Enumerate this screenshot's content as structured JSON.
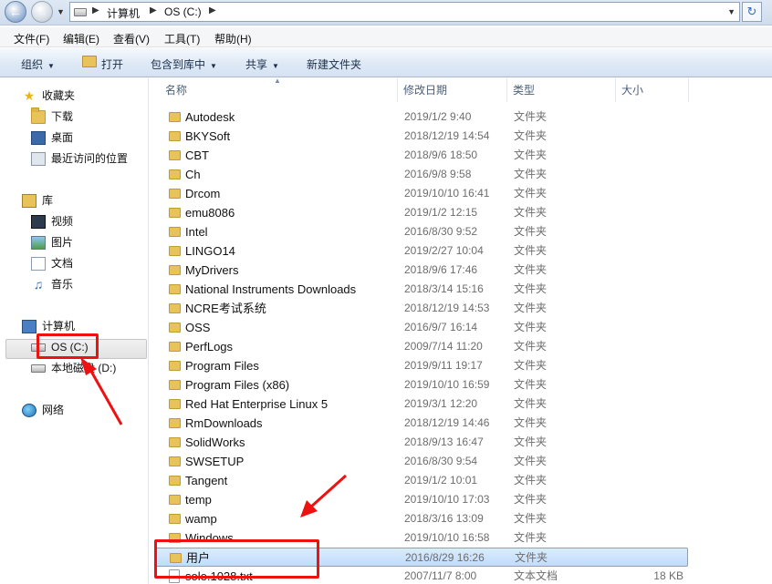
{
  "address_bar": {
    "crumbs": [
      "计算机",
      "OS (C:)"
    ]
  },
  "menu": [
    "文件(F)",
    "编辑(E)",
    "查看(V)",
    "工具(T)",
    "帮助(H)"
  ],
  "toolbar": {
    "organize": "组织",
    "open": "打开",
    "include_library": "包含到库中",
    "share": "共享",
    "new_folder": "新建文件夹"
  },
  "nav": {
    "favorites": {
      "label": "收藏夹",
      "items": [
        "下载",
        "桌面",
        "最近访问的位置"
      ]
    },
    "libraries": {
      "label": "库",
      "items": [
        "视频",
        "图片",
        "文档",
        "音乐"
      ]
    },
    "computer": {
      "label": "计算机",
      "drives": [
        "OS (C:)",
        "本地磁盘 (D:)"
      ]
    },
    "network": {
      "label": "网络"
    }
  },
  "columns": {
    "name": "名称",
    "modified": "修改日期",
    "type": "类型",
    "size": "大小"
  },
  "files": [
    {
      "name": "Autodesk",
      "date": "2019/1/2 9:40",
      "type": "文件夹",
      "size": ""
    },
    {
      "name": "BKYSoft",
      "date": "2018/12/19 14:54",
      "type": "文件夹",
      "size": ""
    },
    {
      "name": "CBT",
      "date": "2018/9/6 18:50",
      "type": "文件夹",
      "size": ""
    },
    {
      "name": "Ch",
      "date": "2016/9/8 9:58",
      "type": "文件夹",
      "size": ""
    },
    {
      "name": "Drcom",
      "date": "2019/10/10 16:41",
      "type": "文件夹",
      "size": ""
    },
    {
      "name": "emu8086",
      "date": "2019/1/2 12:15",
      "type": "文件夹",
      "size": ""
    },
    {
      "name": "Intel",
      "date": "2016/8/30 9:52",
      "type": "文件夹",
      "size": ""
    },
    {
      "name": "LINGO14",
      "date": "2019/2/27 10:04",
      "type": "文件夹",
      "size": ""
    },
    {
      "name": "MyDrivers",
      "date": "2018/9/6 17:46",
      "type": "文件夹",
      "size": ""
    },
    {
      "name": "National Instruments Downloads",
      "date": "2018/3/14 15:16",
      "type": "文件夹",
      "size": ""
    },
    {
      "name": "NCRE考试系统",
      "date": "2018/12/19 14:53",
      "type": "文件夹",
      "size": ""
    },
    {
      "name": "OSS",
      "date": "2016/9/7 16:14",
      "type": "文件夹",
      "size": ""
    },
    {
      "name": "PerfLogs",
      "date": "2009/7/14 11:20",
      "type": "文件夹",
      "size": ""
    },
    {
      "name": "Program Files",
      "date": "2019/9/11 19:17",
      "type": "文件夹",
      "size": ""
    },
    {
      "name": "Program Files (x86)",
      "date": "2019/10/10 16:59",
      "type": "文件夹",
      "size": ""
    },
    {
      "name": "Red Hat Enterprise Linux 5",
      "date": "2019/3/1 12:20",
      "type": "文件夹",
      "size": ""
    },
    {
      "name": "RmDownloads",
      "date": "2018/12/19 14:46",
      "type": "文件夹",
      "size": ""
    },
    {
      "name": "SolidWorks",
      "date": "2018/9/13 16:47",
      "type": "文件夹",
      "size": ""
    },
    {
      "name": "SWSETUP",
      "date": "2016/8/30 9:54",
      "type": "文件夹",
      "size": ""
    },
    {
      "name": "Tangent",
      "date": "2019/1/2 10:01",
      "type": "文件夹",
      "size": ""
    },
    {
      "name": "temp",
      "date": "2019/10/10 17:03",
      "type": "文件夹",
      "size": ""
    },
    {
      "name": "wamp",
      "date": "2018/3/16 13:09",
      "type": "文件夹",
      "size": ""
    },
    {
      "name": "Windows",
      "date": "2019/10/10 16:58",
      "type": "文件夹",
      "size": ""
    },
    {
      "name": "用户",
      "date": "2016/8/29 16:26",
      "type": "文件夹",
      "size": ""
    },
    {
      "name": "sole.1028.txt",
      "date": "2007/11/7 8:00",
      "type": "文本文档",
      "size": "18 KB"
    }
  ],
  "selected_file": "用户",
  "selected_drive": "OS (C:)",
  "annotation_color": "#ee1111"
}
